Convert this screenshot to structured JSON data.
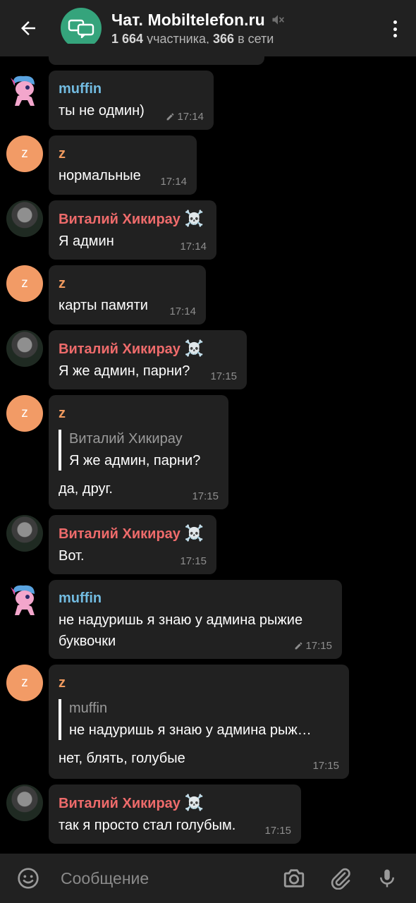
{
  "header": {
    "title": "Чат. Mobiltelefon.ru",
    "subtitle_members": "1 664",
    "subtitle_members_label": "участника,",
    "subtitle_online": "366",
    "subtitle_online_label": "в сети"
  },
  "messages": [
    {
      "sender": "muffin",
      "text": "ты не одмин)",
      "time": "17:14",
      "edited": true
    },
    {
      "sender": "z",
      "avatar_letter": "z",
      "text": "нормальные",
      "time": "17:14"
    },
    {
      "sender": "Виталий Хикирау",
      "badge": "☠️",
      "text": "Я админ",
      "time": "17:14"
    },
    {
      "sender": "z",
      "avatar_letter": "z",
      "text": "карты памяти",
      "time": "17:14"
    },
    {
      "sender": "Виталий Хикирау",
      "badge": "☠️",
      "text": "Я же админ, парни?",
      "time": "17:15"
    },
    {
      "sender": "z",
      "avatar_letter": "z",
      "quote_name": "Виталий Хикирау",
      "quote_text": "Я же админ, парни?",
      "text": "да, друг.",
      "time": "17:15"
    },
    {
      "sender": "Виталий Хикирау",
      "badge": "☠️",
      "text": "Вот.",
      "time": "17:15"
    },
    {
      "sender": "muffin",
      "text_line1": "не надуришь я знаю у админа рыжие",
      "text_line2": "буквочки",
      "time": "17:15",
      "edited": true
    },
    {
      "sender": "z",
      "avatar_letter": "z",
      "quote_name": "muffin",
      "quote_text": "не надуришь я знаю у админа рыж…",
      "text": "нет, блять, голубые",
      "time": "17:15"
    },
    {
      "sender": "Виталий Хикирау",
      "badge": "☠️",
      "text": "так я просто стал голубым.",
      "time": "17:15"
    }
  ],
  "input": {
    "placeholder": "Сообщение"
  },
  "colors": {
    "header_bg": "#212121",
    "bubble_bg": "#212121",
    "name_muffin": "#72bbe0",
    "name_z": "#f09a5f",
    "name_vitaliy": "#ee6b6b",
    "avatar_chat": "#35a47c",
    "avatar_z": "#f29b66"
  }
}
